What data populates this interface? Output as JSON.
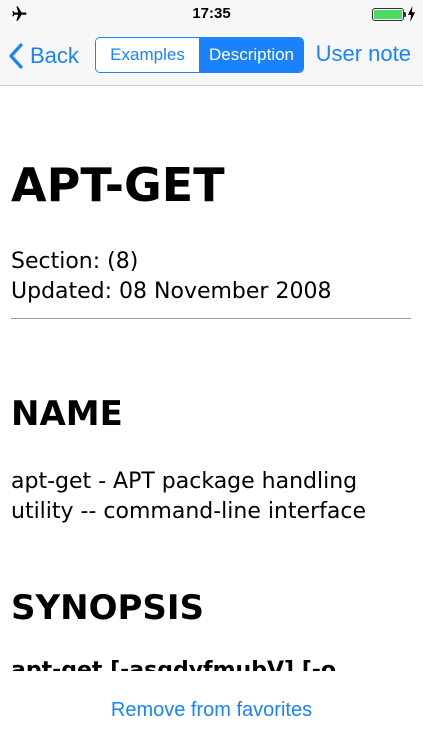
{
  "status": {
    "time": "17:35",
    "battery_level": 1.0
  },
  "nav": {
    "back_label": "Back",
    "segments": [
      {
        "label": "Examples"
      },
      {
        "label": "Description"
      }
    ],
    "selected_segment": "Description",
    "user_note_label": "User note",
    "accent_color": "#1a82fb"
  },
  "content": {
    "title": "APT-GET",
    "section_line": "Section: (8)",
    "updated_line": "Updated: 08 November 2008",
    "name_heading": "NAME",
    "name_text": "apt-get - APT package handling utility -- command-line interface",
    "synopsis_heading": "SYNOPSIS",
    "synopsis_text": "apt-get [-asqdyfmubV] [-o"
  },
  "footer": {
    "remove_favorites_label": "Remove from favorites"
  },
  "icons": {
    "airplane": "airplane-icon",
    "battery": "battery-icon",
    "charging": "charging-bolt-icon",
    "back": "chevron-left-icon"
  }
}
